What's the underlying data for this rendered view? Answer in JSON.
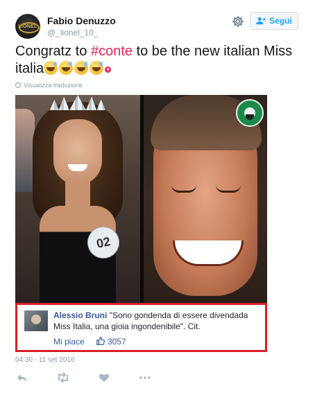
{
  "author": {
    "name": "Fabio Denuzzo",
    "handle": "@_lionel_10_",
    "avatar_text": "LIONEL"
  },
  "header": {
    "follow_label": "Segui",
    "settings_icon": "gear-icon",
    "follow_icon": "add-user-icon"
  },
  "tweet": {
    "text_before": "Congratz to ",
    "hashtag": "#conte",
    "text_after": " to be the new italian Miss italia",
    "emojis": [
      "grinning-sweat-emoji",
      "grinning-sweat-emoji",
      "grinning-sweat-emoji",
      "grinning-sweat-emoji"
    ],
    "translate_label": "Visualizza traduzione"
  },
  "media": {
    "badge_number": "02",
    "overlay_comment": {
      "author": "Alessio Bruni",
      "text": "\"Sono gondenda di essere divendada Miss Italia, una gioia ingondenibile\". Cit.",
      "like_label": "Mi piace",
      "like_count": "3057"
    }
  },
  "footer": {
    "timestamp": "04:30 - 11 set 2016",
    "actions": [
      "reply-icon",
      "retweet-icon",
      "like-icon",
      "more-icon"
    ]
  },
  "colors": {
    "hashtag": "#e0245e",
    "link_blue": "#1da1f2",
    "fb_blue": "#365899",
    "highlight_red": "#d81f26",
    "muted": "#8899a6"
  }
}
